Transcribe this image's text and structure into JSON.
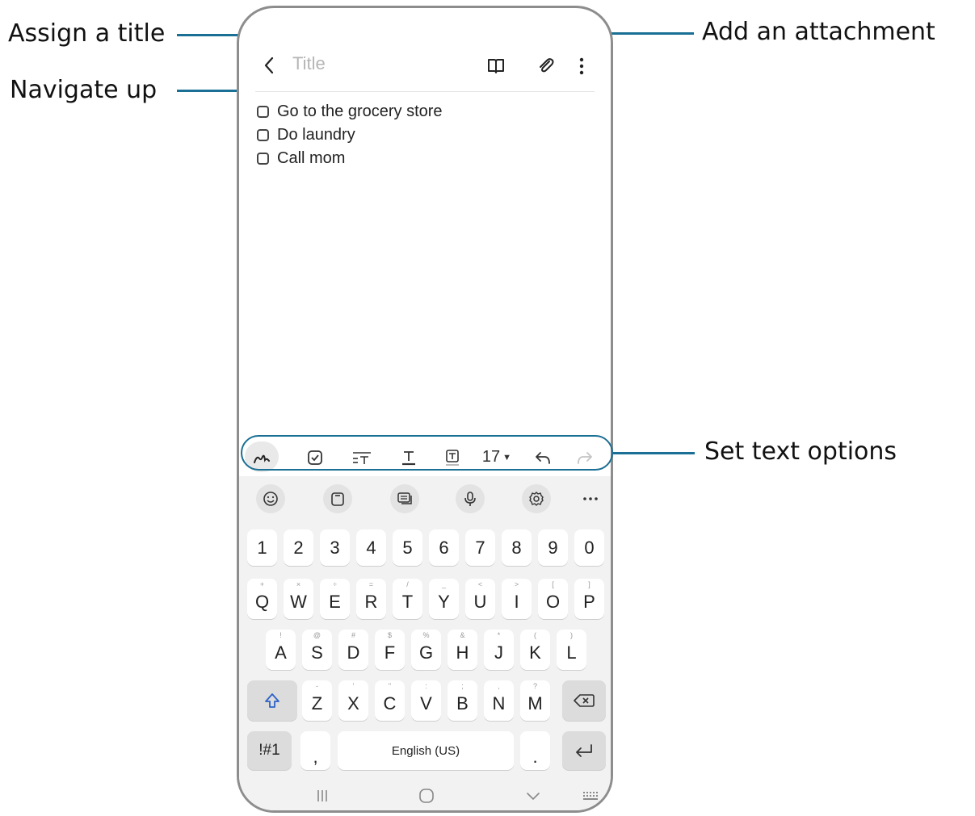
{
  "callouts": {
    "assign_title": "Assign a title",
    "navigate_up": "Navigate up",
    "add_attachment": "Add an attachment",
    "text_options": "Set text options"
  },
  "note": {
    "title_placeholder": "Title",
    "items": [
      {
        "label": "Go to the grocery store",
        "checked": false
      },
      {
        "label": "Do laundry",
        "checked": false
      },
      {
        "label": "Call mom",
        "checked": false
      }
    ]
  },
  "toolbar": {
    "font_size": "17"
  },
  "keyboard": {
    "number_row": [
      "1",
      "2",
      "3",
      "4",
      "5",
      "6",
      "7",
      "8",
      "9",
      "0"
    ],
    "row1": [
      {
        "k": "Q",
        "s": "+"
      },
      {
        "k": "W",
        "s": "×"
      },
      {
        "k": "E",
        "s": "÷"
      },
      {
        "k": "R",
        "s": "="
      },
      {
        "k": "T",
        "s": "/"
      },
      {
        "k": "Y",
        "s": "_"
      },
      {
        "k": "U",
        "s": "<"
      },
      {
        "k": "I",
        "s": ">"
      },
      {
        "k": "O",
        "s": "["
      },
      {
        "k": "P",
        "s": "]"
      }
    ],
    "row2": [
      {
        "k": "A",
        "s": "!"
      },
      {
        "k": "S",
        "s": "@"
      },
      {
        "k": "D",
        "s": "#"
      },
      {
        "k": "F",
        "s": "$"
      },
      {
        "k": "G",
        "s": "%"
      },
      {
        "k": "H",
        "s": "&"
      },
      {
        "k": "J",
        "s": "*"
      },
      {
        "k": "K",
        "s": "("
      },
      {
        "k": "L",
        "s": ")"
      }
    ],
    "row3": [
      {
        "k": "Z",
        "s": "-"
      },
      {
        "k": "X",
        "s": "'"
      },
      {
        "k": "C",
        "s": "\""
      },
      {
        "k": "V",
        "s": ":"
      },
      {
        "k": "B",
        "s": ";"
      },
      {
        "k": "N",
        "s": ","
      },
      {
        "k": "M",
        "s": "?"
      }
    ],
    "symbols_label": "!#1",
    "comma": ",",
    "space_label": "English (US)",
    "period": "."
  },
  "colors": {
    "callout_line": "#1a6f94",
    "phone_border": "#8d8d8d"
  }
}
